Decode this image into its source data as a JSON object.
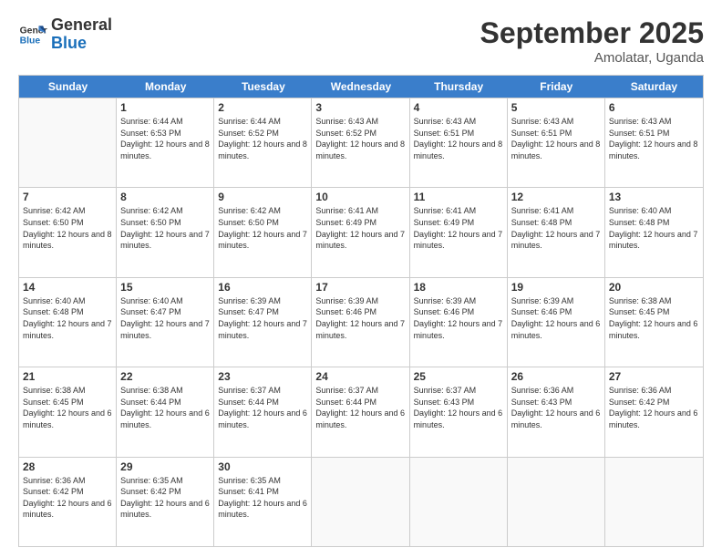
{
  "header": {
    "logo_general": "General",
    "logo_blue": "Blue",
    "month": "September 2025",
    "location": "Amolatar, Uganda"
  },
  "days_of_week": [
    "Sunday",
    "Monday",
    "Tuesday",
    "Wednesday",
    "Thursday",
    "Friday",
    "Saturday"
  ],
  "weeks": [
    [
      {
        "day": "",
        "empty": true
      },
      {
        "day": "1",
        "sunrise": "6:44 AM",
        "sunset": "6:53 PM",
        "daylight": "12 hours and 8 minutes."
      },
      {
        "day": "2",
        "sunrise": "6:44 AM",
        "sunset": "6:52 PM",
        "daylight": "12 hours and 8 minutes."
      },
      {
        "day": "3",
        "sunrise": "6:43 AM",
        "sunset": "6:52 PM",
        "daylight": "12 hours and 8 minutes."
      },
      {
        "day": "4",
        "sunrise": "6:43 AM",
        "sunset": "6:51 PM",
        "daylight": "12 hours and 8 minutes."
      },
      {
        "day": "5",
        "sunrise": "6:43 AM",
        "sunset": "6:51 PM",
        "daylight": "12 hours and 8 minutes."
      },
      {
        "day": "6",
        "sunrise": "6:43 AM",
        "sunset": "6:51 PM",
        "daylight": "12 hours and 8 minutes."
      }
    ],
    [
      {
        "day": "7",
        "sunrise": "6:42 AM",
        "sunset": "6:50 PM",
        "daylight": "12 hours and 8 minutes."
      },
      {
        "day": "8",
        "sunrise": "6:42 AM",
        "sunset": "6:50 PM",
        "daylight": "12 hours and 7 minutes."
      },
      {
        "day": "9",
        "sunrise": "6:42 AM",
        "sunset": "6:50 PM",
        "daylight": "12 hours and 7 minutes."
      },
      {
        "day": "10",
        "sunrise": "6:41 AM",
        "sunset": "6:49 PM",
        "daylight": "12 hours and 7 minutes."
      },
      {
        "day": "11",
        "sunrise": "6:41 AM",
        "sunset": "6:49 PM",
        "daylight": "12 hours and 7 minutes."
      },
      {
        "day": "12",
        "sunrise": "6:41 AM",
        "sunset": "6:48 PM",
        "daylight": "12 hours and 7 minutes."
      },
      {
        "day": "13",
        "sunrise": "6:40 AM",
        "sunset": "6:48 PM",
        "daylight": "12 hours and 7 minutes."
      }
    ],
    [
      {
        "day": "14",
        "sunrise": "6:40 AM",
        "sunset": "6:48 PM",
        "daylight": "12 hours and 7 minutes."
      },
      {
        "day": "15",
        "sunrise": "6:40 AM",
        "sunset": "6:47 PM",
        "daylight": "12 hours and 7 minutes."
      },
      {
        "day": "16",
        "sunrise": "6:39 AM",
        "sunset": "6:47 PM",
        "daylight": "12 hours and 7 minutes."
      },
      {
        "day": "17",
        "sunrise": "6:39 AM",
        "sunset": "6:46 PM",
        "daylight": "12 hours and 7 minutes."
      },
      {
        "day": "18",
        "sunrise": "6:39 AM",
        "sunset": "6:46 PM",
        "daylight": "12 hours and 7 minutes."
      },
      {
        "day": "19",
        "sunrise": "6:39 AM",
        "sunset": "6:46 PM",
        "daylight": "12 hours and 6 minutes."
      },
      {
        "day": "20",
        "sunrise": "6:38 AM",
        "sunset": "6:45 PM",
        "daylight": "12 hours and 6 minutes."
      }
    ],
    [
      {
        "day": "21",
        "sunrise": "6:38 AM",
        "sunset": "6:45 PM",
        "daylight": "12 hours and 6 minutes."
      },
      {
        "day": "22",
        "sunrise": "6:38 AM",
        "sunset": "6:44 PM",
        "daylight": "12 hours and 6 minutes."
      },
      {
        "day": "23",
        "sunrise": "6:37 AM",
        "sunset": "6:44 PM",
        "daylight": "12 hours and 6 minutes."
      },
      {
        "day": "24",
        "sunrise": "6:37 AM",
        "sunset": "6:44 PM",
        "daylight": "12 hours and 6 minutes."
      },
      {
        "day": "25",
        "sunrise": "6:37 AM",
        "sunset": "6:43 PM",
        "daylight": "12 hours and 6 minutes."
      },
      {
        "day": "26",
        "sunrise": "6:36 AM",
        "sunset": "6:43 PM",
        "daylight": "12 hours and 6 minutes."
      },
      {
        "day": "27",
        "sunrise": "6:36 AM",
        "sunset": "6:42 PM",
        "daylight": "12 hours and 6 minutes."
      }
    ],
    [
      {
        "day": "28",
        "sunrise": "6:36 AM",
        "sunset": "6:42 PM",
        "daylight": "12 hours and 6 minutes."
      },
      {
        "day": "29",
        "sunrise": "6:35 AM",
        "sunset": "6:42 PM",
        "daylight": "12 hours and 6 minutes."
      },
      {
        "day": "30",
        "sunrise": "6:35 AM",
        "sunset": "6:41 PM",
        "daylight": "12 hours and 6 minutes."
      },
      {
        "day": "",
        "empty": true
      },
      {
        "day": "",
        "empty": true
      },
      {
        "day": "",
        "empty": true
      },
      {
        "day": "",
        "empty": true
      }
    ]
  ]
}
